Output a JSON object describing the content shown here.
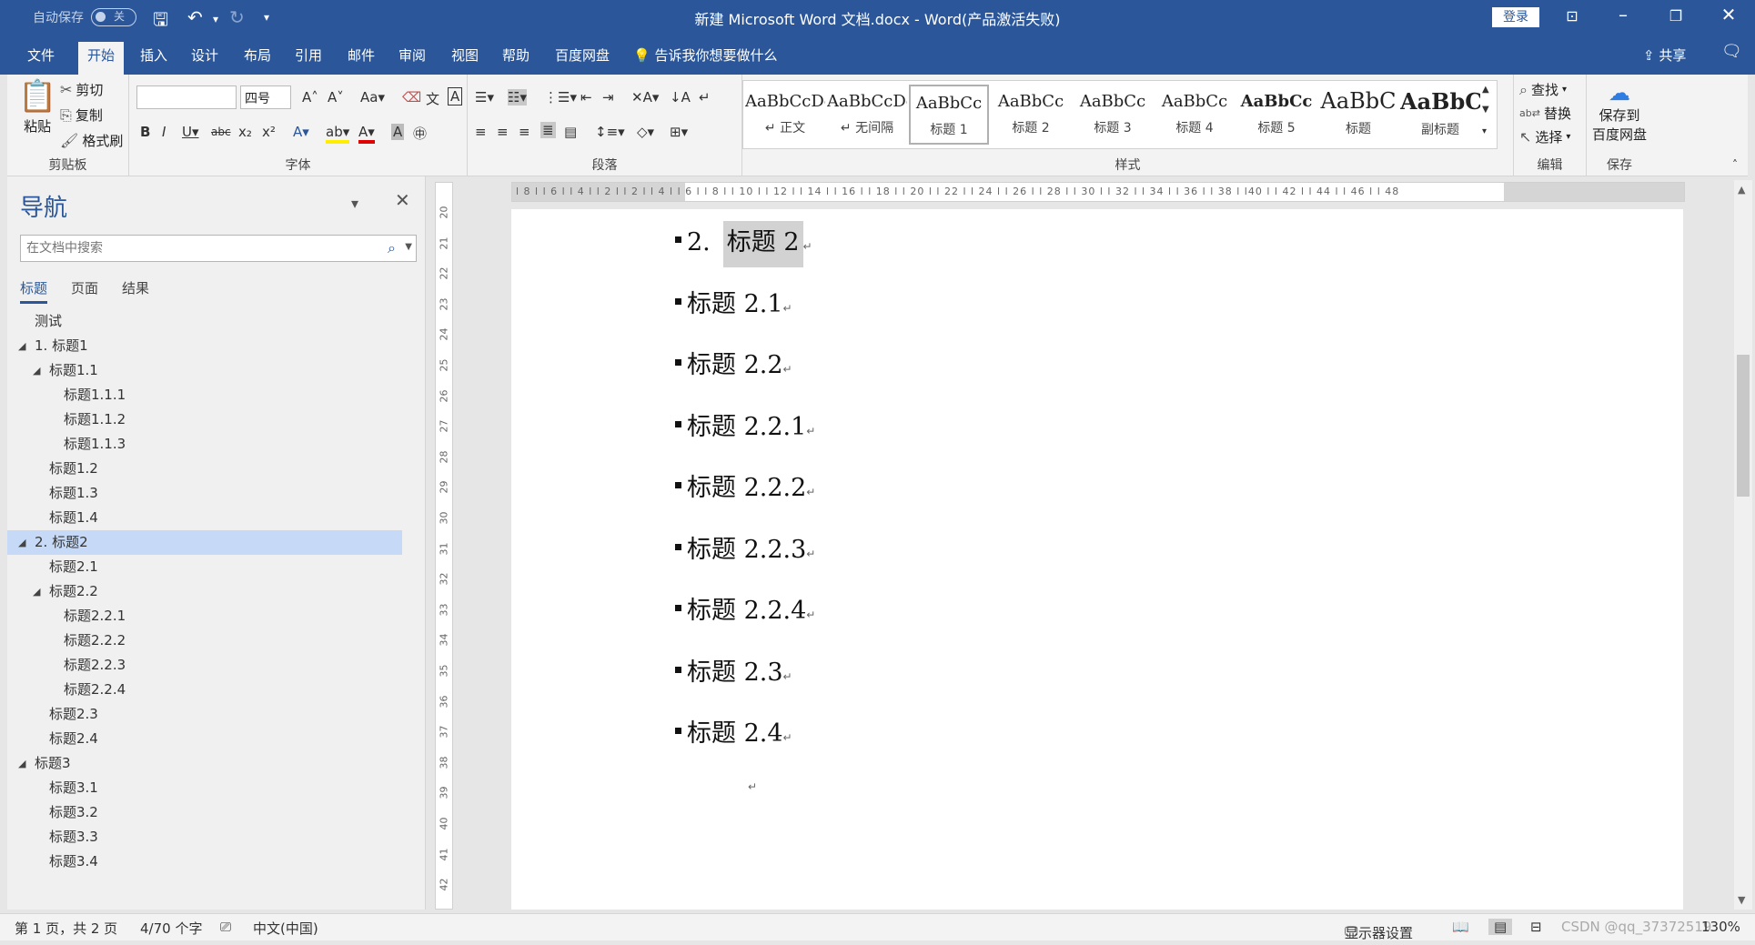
{
  "titlebar": {
    "autosave_label": "自动保存",
    "autosave_state": "关",
    "title": "新建 Microsoft Word 文档.docx  -  Word(产品激活失败)",
    "login_label": "登录"
  },
  "ribbon_tabs": [
    "文件",
    "开始",
    "插入",
    "设计",
    "布局",
    "引用",
    "邮件",
    "审阅",
    "视图",
    "帮助",
    "百度网盘"
  ],
  "tell_me": "告诉我你想要做什么",
  "share_label": "共享",
  "clipboard": {
    "paste": "粘贴",
    "cut": "剪切",
    "copy": "复制",
    "format_painter": "格式刷",
    "group_label": "剪贴板"
  },
  "font_group": {
    "font_name": "",
    "font_size": "四号",
    "group_label": "字体"
  },
  "paragraph_group": {
    "group_label": "段落"
  },
  "styles_group": {
    "group_label": "样式",
    "items": [
      {
        "sample": "AaBbCcDc",
        "name": "↵ 正文"
      },
      {
        "sample": "AaBbCcDc",
        "name": "↵ 无间隔"
      },
      {
        "sample": "AaBbCc",
        "name": "标题 1"
      },
      {
        "sample": "AaBbCc",
        "name": "标题 2"
      },
      {
        "sample": "AaBbCc",
        "name": "标题 3"
      },
      {
        "sample": "AaBbCc",
        "name": "标题 4"
      },
      {
        "sample": "AaBbCc",
        "name": "标题 5"
      },
      {
        "sample": "AaBbC",
        "name": "标题"
      },
      {
        "sample": "AaBbC",
        "name": "副标题"
      }
    ]
  },
  "editing_group": {
    "find": "查找",
    "replace": "替换",
    "select": "选择",
    "group_label": "编辑"
  },
  "save_group": {
    "button_line1": "保存到",
    "button_line2": "百度网盘",
    "group_label": "保存"
  },
  "nav": {
    "title": "导航",
    "search_placeholder": "在文档中搜索",
    "tabs": [
      "标题",
      "页面",
      "结果"
    ],
    "tree": [
      {
        "label": "测试",
        "level": 0,
        "expander": false
      },
      {
        "label": "1. 标题1",
        "level": 0,
        "expander": true
      },
      {
        "label": "标题1.1",
        "level": 1,
        "expander": true
      },
      {
        "label": "标题1.1.1",
        "level": 2,
        "expander": false
      },
      {
        "label": "标题1.1.2",
        "level": 2,
        "expander": false
      },
      {
        "label": "标题1.1.3",
        "level": 2,
        "expander": false
      },
      {
        "label": "标题1.2",
        "level": 1,
        "expander": false
      },
      {
        "label": "标题1.3",
        "level": 1,
        "expander": false
      },
      {
        "label": "标题1.4",
        "level": 1,
        "expander": false
      },
      {
        "label": "2. 标题2",
        "level": 0,
        "expander": true,
        "selected": true
      },
      {
        "label": "标题2.1",
        "level": 1,
        "expander": false
      },
      {
        "label": "标题2.2",
        "level": 1,
        "expander": true
      },
      {
        "label": "标题2.2.1",
        "level": 2,
        "expander": false
      },
      {
        "label": "标题2.2.2",
        "level": 2,
        "expander": false
      },
      {
        "label": "标题2.2.3",
        "level": 2,
        "expander": false
      },
      {
        "label": "标题2.2.4",
        "level": 2,
        "expander": false
      },
      {
        "label": "标题2.3",
        "level": 1,
        "expander": false
      },
      {
        "label": "标题2.4",
        "level": 1,
        "expander": false
      },
      {
        "label": "标题3",
        "level": 0,
        "expander": true
      },
      {
        "label": "标题3.1",
        "level": 1,
        "expander": false
      },
      {
        "label": "标题3.2",
        "level": 1,
        "expander": false
      },
      {
        "label": "标题3.3",
        "level": 1,
        "expander": false
      },
      {
        "label": "标题3.4",
        "level": 1,
        "expander": false
      }
    ]
  },
  "document": {
    "headings": [
      {
        "number": "2.",
        "text": "标题 2",
        "highlight": true
      },
      {
        "number": "",
        "text": "标题 2.1"
      },
      {
        "number": "",
        "text": "标题 2.2"
      },
      {
        "number": "",
        "text": "标题 2.2.1"
      },
      {
        "number": "",
        "text": "标题 2.2.2"
      },
      {
        "number": "",
        "text": "标题 2.2.3"
      },
      {
        "number": "",
        "text": "标题 2.2.4"
      },
      {
        "number": "",
        "text": "标题 2.3"
      },
      {
        "number": "",
        "text": "标题 2.4"
      }
    ],
    "paragraph_mark": "↵"
  },
  "ruler": {
    "h_ticks": "l 8 l   l 6 l   l 4 l   l 2 l        l   2 l   l 4 l   l 6 l   l 8 l   l 10 l  l 12 l  l 14 l  l 16 l  l 18 l  l 20 l  l 22 l  l 24 l  l 26 l  l 28 l  l 30 l  l 32 l  l 34 l  l 36 l  l 38 l    l40 l  l 42 l  l 44 l  l 46 l  l 48",
    "v_ticks": [
      "20",
      "21",
      "22",
      "23",
      "24",
      "25",
      "26",
      "27",
      "28",
      "29",
      "30",
      "31",
      "32",
      "33",
      "34",
      "35",
      "36",
      "37",
      "38",
      "39",
      "40",
      "41",
      "42"
    ]
  },
  "status": {
    "page": "第 1 页，共 2 页",
    "words": "4/70 个字",
    "language": "中文(中国)",
    "display_settings": "显示器设置",
    "zoom": "130%",
    "watermark": "CSDN @qq_37372519"
  }
}
